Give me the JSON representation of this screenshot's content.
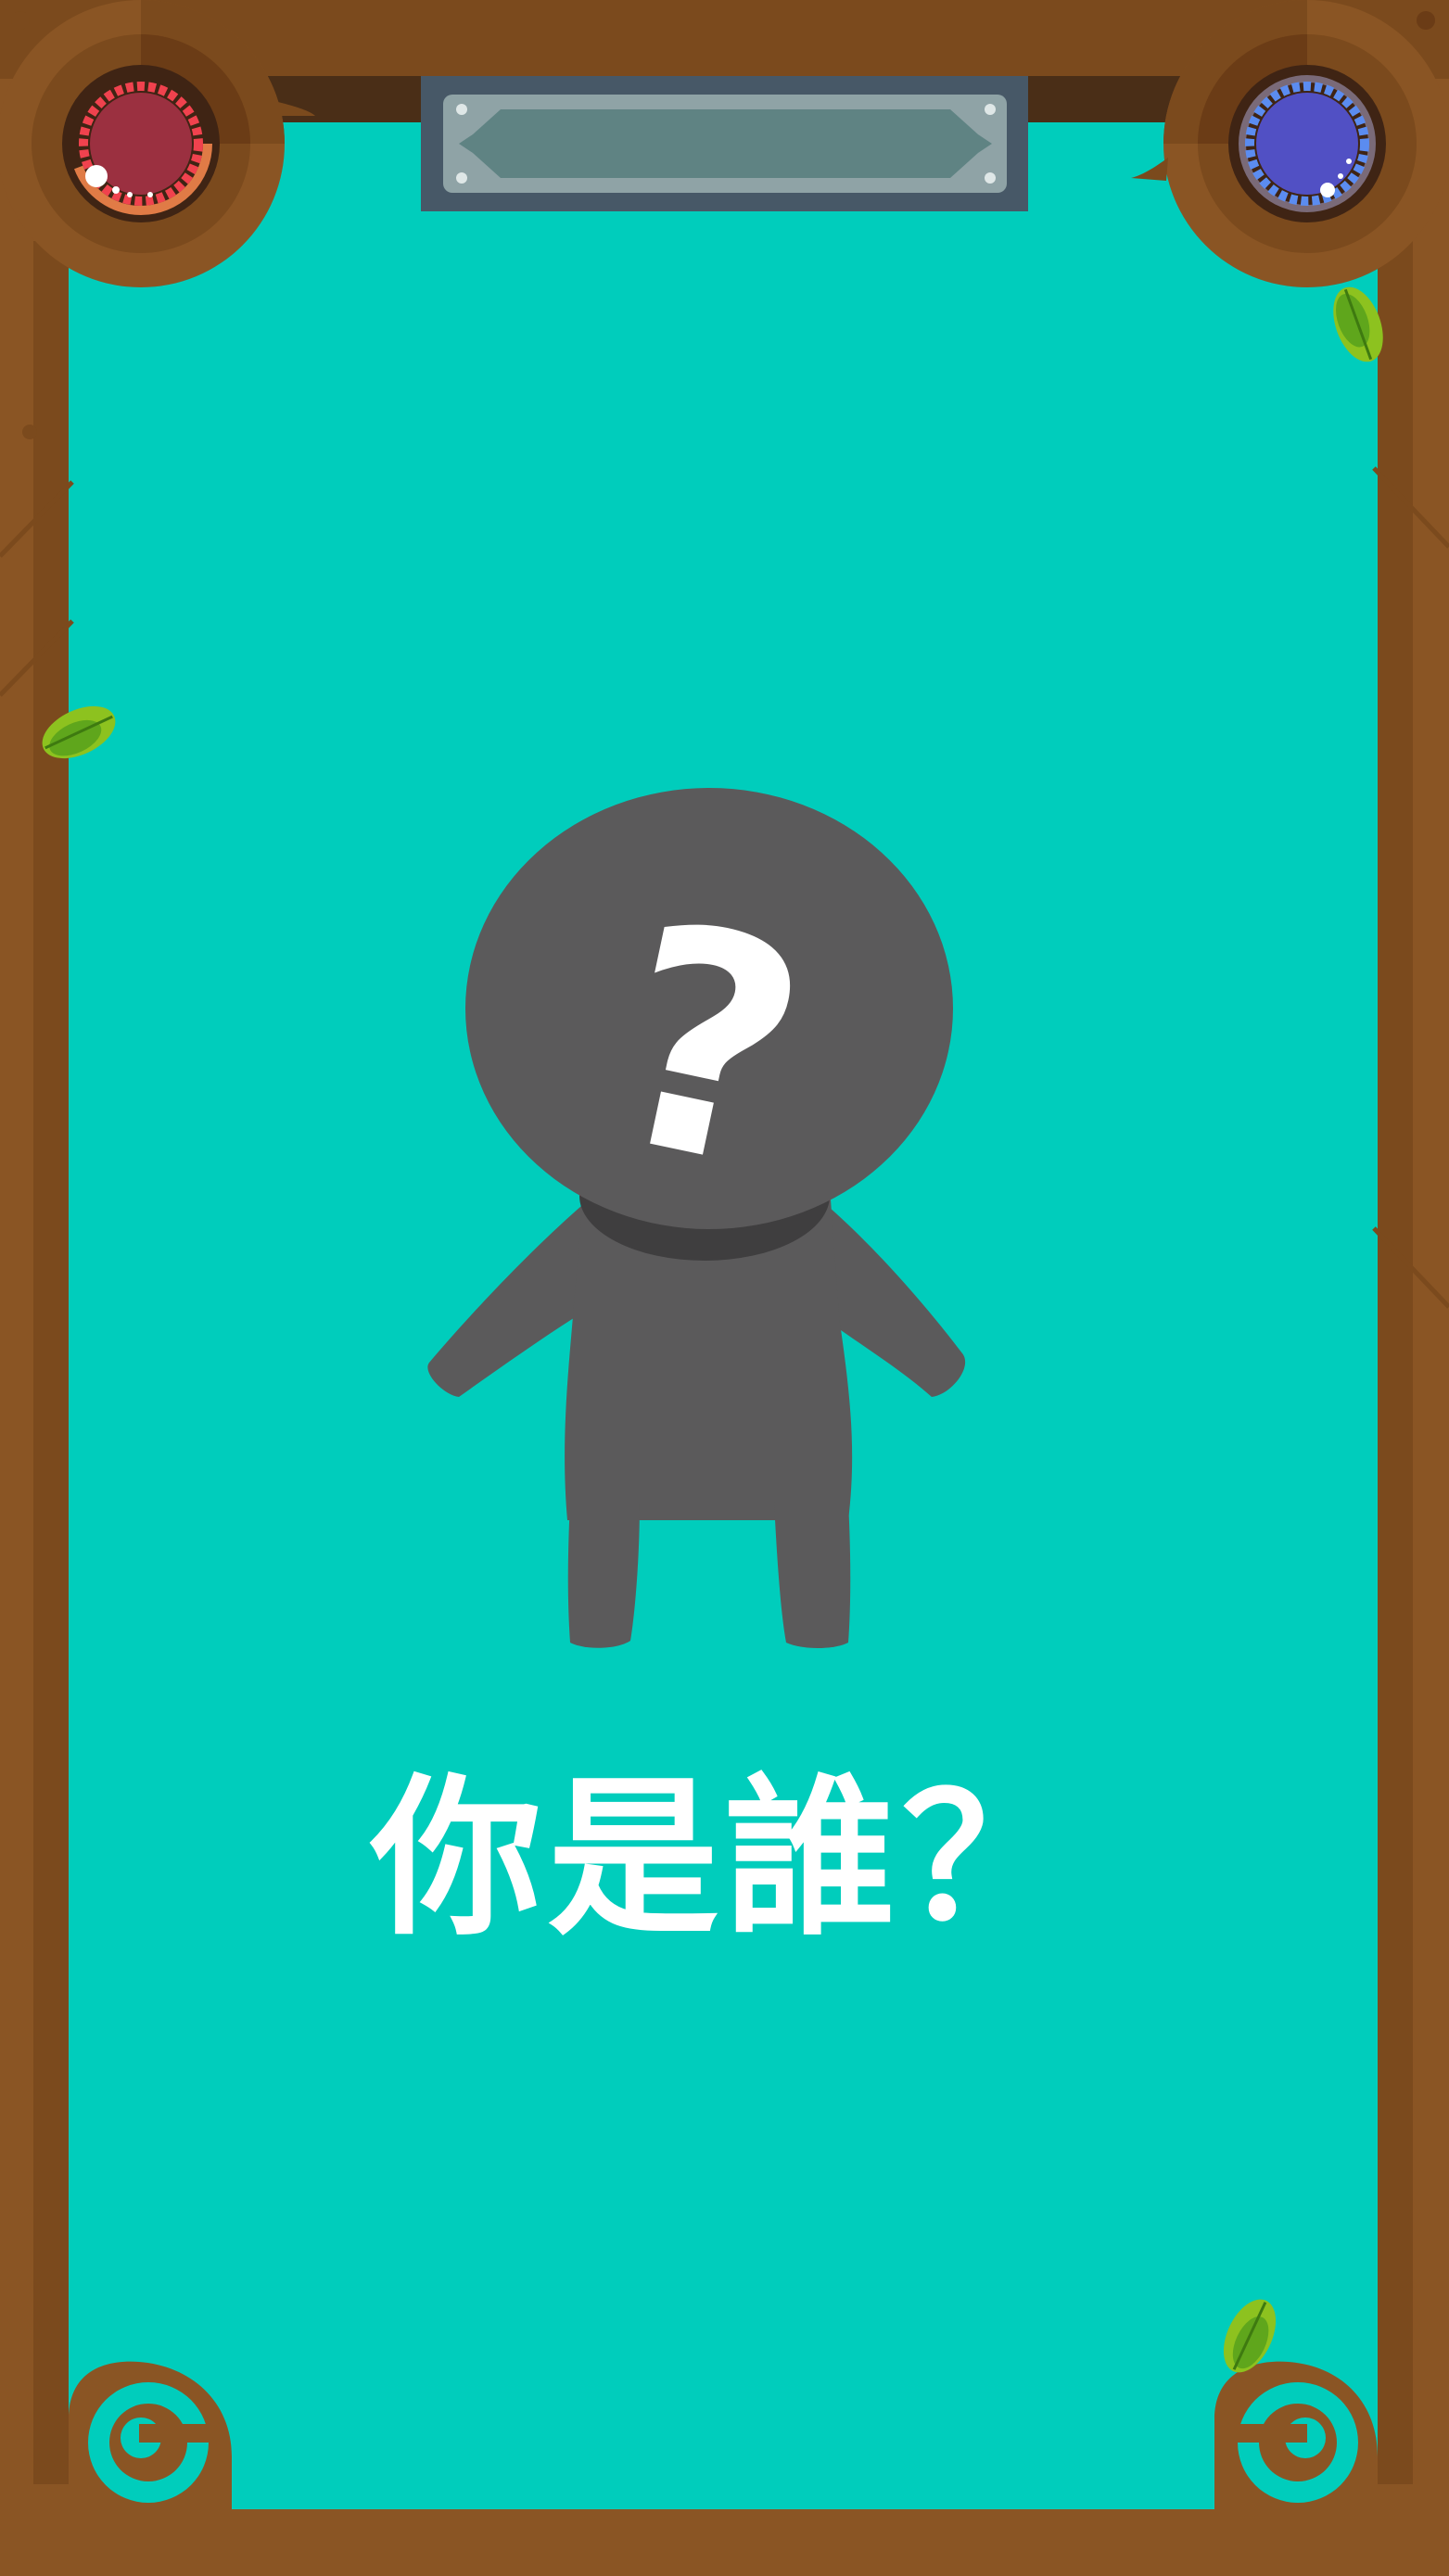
{
  "screen": {
    "prompt_text": "你是誰？",
    "silhouette_symbol": "?"
  },
  "hud": {
    "left_orb": {
      "icon": "health-orb-icon",
      "color": "#9b3040",
      "ring_color": "#f0424e"
    },
    "right_orb": {
      "icon": "mana-orb-icon",
      "color": "#5150c4",
      "ring_color": "#5b8cf0"
    },
    "title_plaque": {
      "text": ""
    }
  },
  "colors": {
    "background": "#00cdbc",
    "frame": "#8a5524",
    "frame_dark": "#6f4119",
    "silhouette": "#5b5a5b",
    "text": "#ffffff"
  }
}
